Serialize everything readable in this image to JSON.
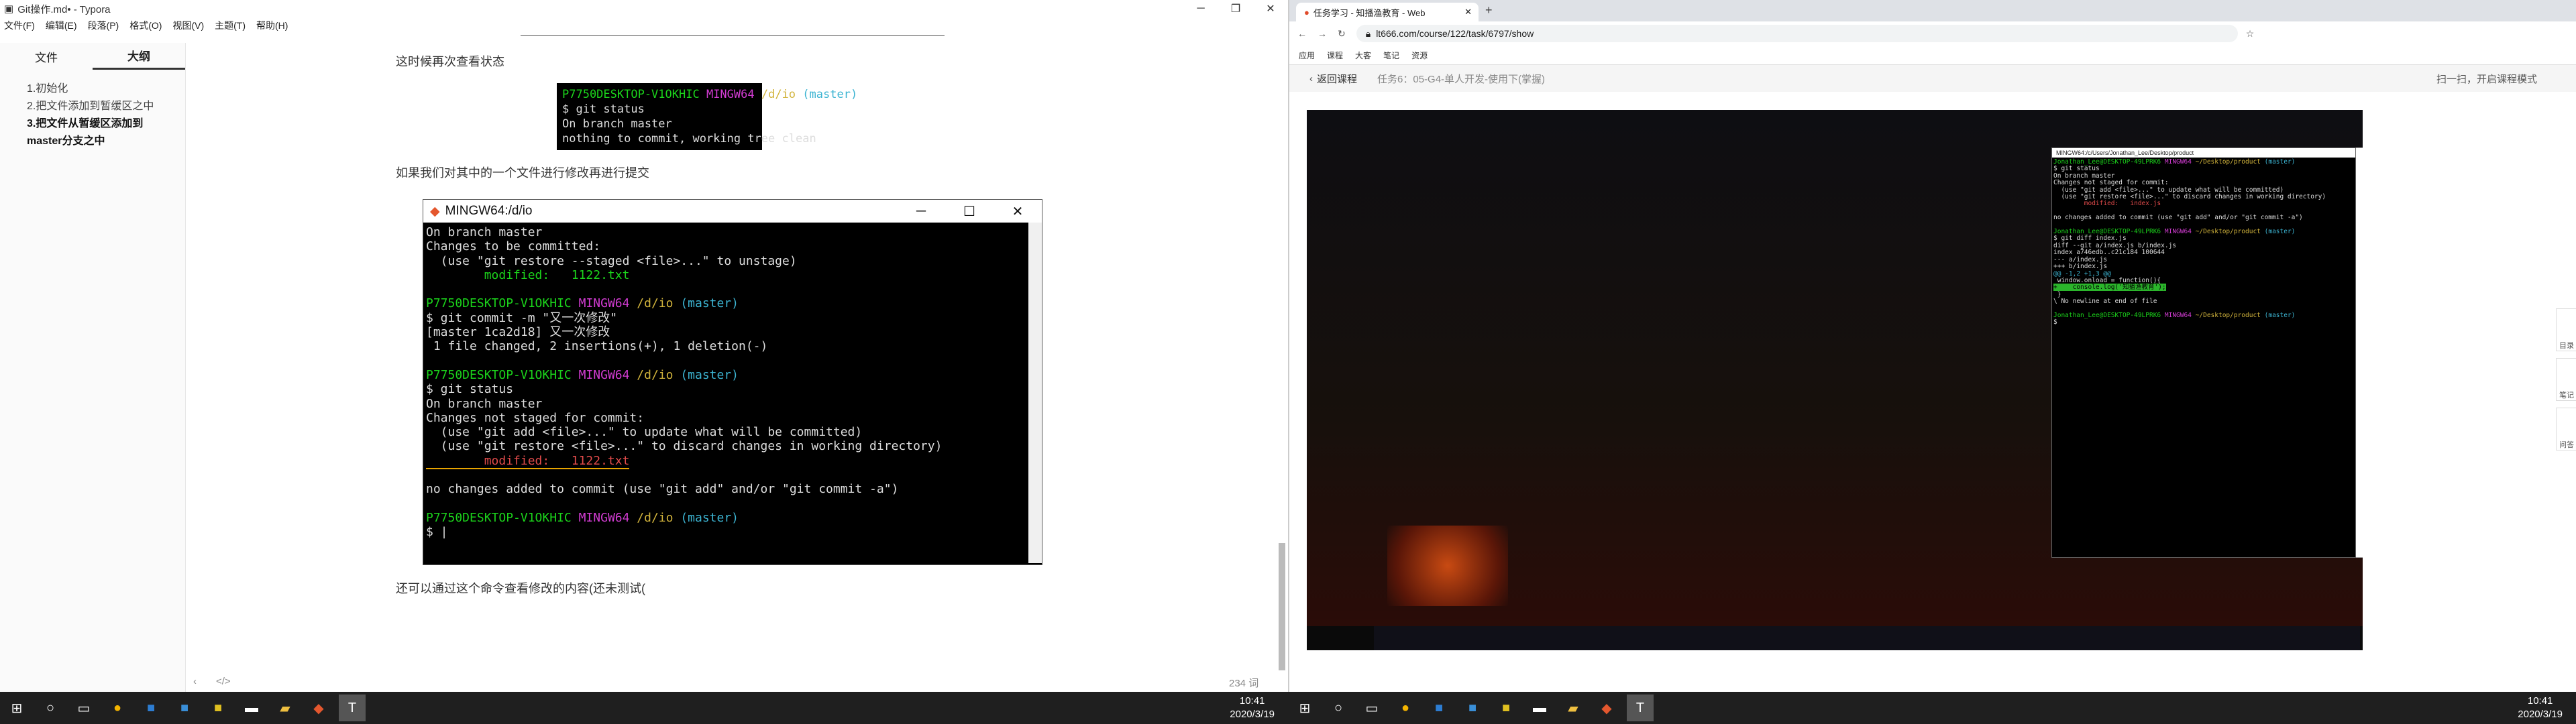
{
  "typora": {
    "title": "Git操作.md• - Typora",
    "menu": [
      "文件(F)",
      "编辑(E)",
      "段落(P)",
      "格式(O)",
      "视图(V)",
      "主题(T)",
      "帮助(H)"
    ],
    "sidebar_tabs": [
      "文件",
      "大纲"
    ],
    "outline": [
      "1.初始化",
      "2.把文件添加到暂缓区之中",
      "3.把文件从暂缓区添加到master分支之中"
    ],
    "para1": "这时候再次查看状态",
    "para2": "如果我们对其中的一个文件进行修改再进行提交",
    "para3": "还可以通过这个命令查看修改的内容(还未测试(",
    "img_prompt_user": "P7750DESKTOP-V1OKHIC",
    "img_prompt_shell": "MINGW64",
    "img_prompt_path": "/d/io",
    "img_prompt_branch": "(master)",
    "img_cmd": "$ git status",
    "img_line1": "On branch master",
    "img_line2": "nothing to commit, working tree clean",
    "term_title": "MINGW64:/d/io",
    "term_lines": {
      "l1": "On branch master",
      "l2": "Changes to be committed:",
      "l3": "  (use \"git restore --staged <file>...\" to unstage)",
      "l4": "        modified:   1122.txt",
      "p1": "P7750DESKTOP-V1OKHIC",
      "cmd2": "$ git commit -m \"又一次修改\"",
      "l5": "[master 1ca2d18] 又一次修改",
      "l6": " 1 file changed, 2 insertions(+), 1 deletion(-)",
      "cmd3": "$ git status",
      "l7": "On branch master",
      "l8": "Changes not staged for commit:",
      "l9": "  (use \"git add <file>...\" to update what will be committed)",
      "l10": "  (use \"git restore <file>...\" to discard changes in working directory)",
      "l11": "        modified:   1122.txt",
      "l12": "no changes added to commit (use \"git add\" and/or \"git commit -a\")",
      "cmd4": "$ |"
    },
    "word_count": "234 词"
  },
  "browser": {
    "tab_title": "任务学习 - 知播渔教育 - Web",
    "url": "lt666.com/course/122/task/6797/show",
    "bookmarks": [
      "应用",
      "课程",
      "大客",
      "笔记",
      "资源"
    ],
    "back_label": "返回课程",
    "task_title": "任务6：05-G4-单人开发-使用下(掌握)",
    "qr_hint": "扫一扫，开启课程模式",
    "tools": [
      "目录",
      "笔记",
      "问答"
    ],
    "vt_title": "MINGW64:/c/Users/Jonathan_Lee/Desktop/product",
    "vt": {
      "user": "Jonathan_Lee@DESKTOP-49LPRK6",
      "shell": "MINGW64",
      "path": "~/Desktop/product",
      "branch": "(master)",
      "c1": "$ git status",
      "a1": "On branch master",
      "a2": "Changes not staged for commit:",
      "a3": "  (use \"git add <file>...\" to update what will be committed)",
      "a4": "  (use \"git restore <file>...\" to discard changes in working directory)",
      "a5": "        modified:   index.js",
      "a6": "no changes added to commit (use \"git add\" and/or \"git commit -a\")",
      "c2": "$ git diff index.js",
      "d1": "diff --git a/index.js b/index.js",
      "d2": "index a746edb..c21c184 100644",
      "d3": "--- a/index.js",
      "d4": "+++ b/index.js",
      "d5": "@@ -1,2 +1,3 @@",
      "d6": " window.onload = function(){",
      "d7": "+    console.log('知播渔教育');",
      "d8": " }",
      "d9": "\\ No newline at end of file",
      "c3": "$"
    }
  },
  "taskbar": {
    "time": "10:41",
    "date": "2020/3/19"
  },
  "colors": {
    "prompt_green": "#1bd31b",
    "shell_magenta": "#d23cd2",
    "path_yellow": "#d2b43c",
    "branch_cyan": "#3cb4d2",
    "modified_red": "#e24b4b"
  }
}
